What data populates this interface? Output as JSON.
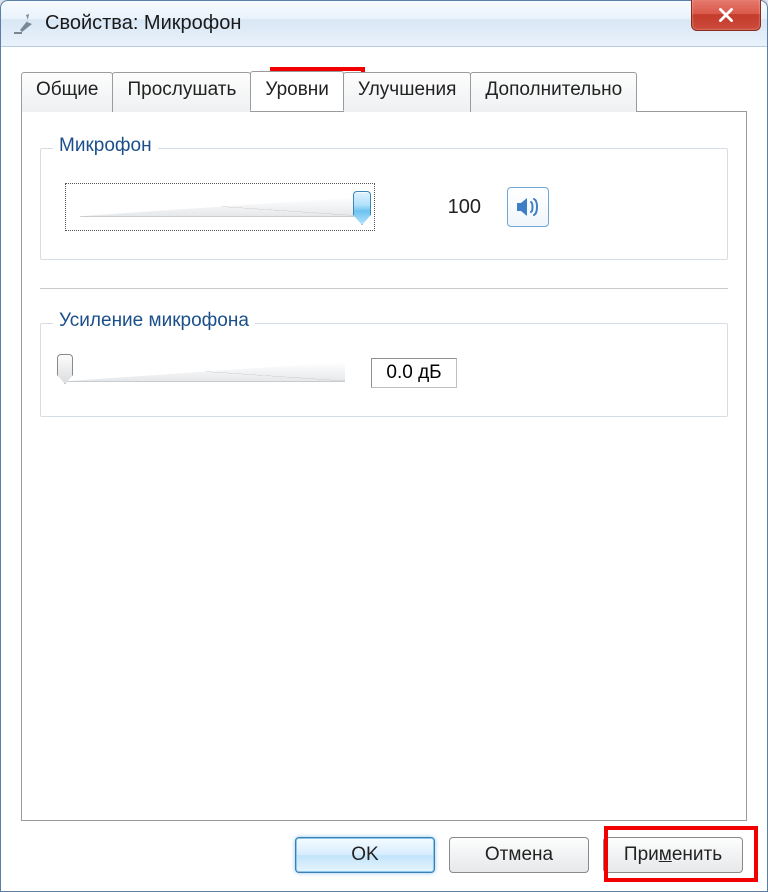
{
  "window": {
    "title": "Свойства: Микрофон"
  },
  "tabs": {
    "general": "Общие",
    "listen": "Прослушать",
    "levels": "Уровни",
    "enhancements": "Улучшения",
    "advanced": "Дополнительно"
  },
  "mic_group": {
    "label": "Микрофон",
    "value": "100"
  },
  "boost_group": {
    "label": "Усиление микрофона",
    "value": "0.0 дБ"
  },
  "buttons": {
    "ok": "OK",
    "cancel": "Отмена",
    "apply_pre": "При",
    "apply_u": "м",
    "apply_post": "енить"
  }
}
